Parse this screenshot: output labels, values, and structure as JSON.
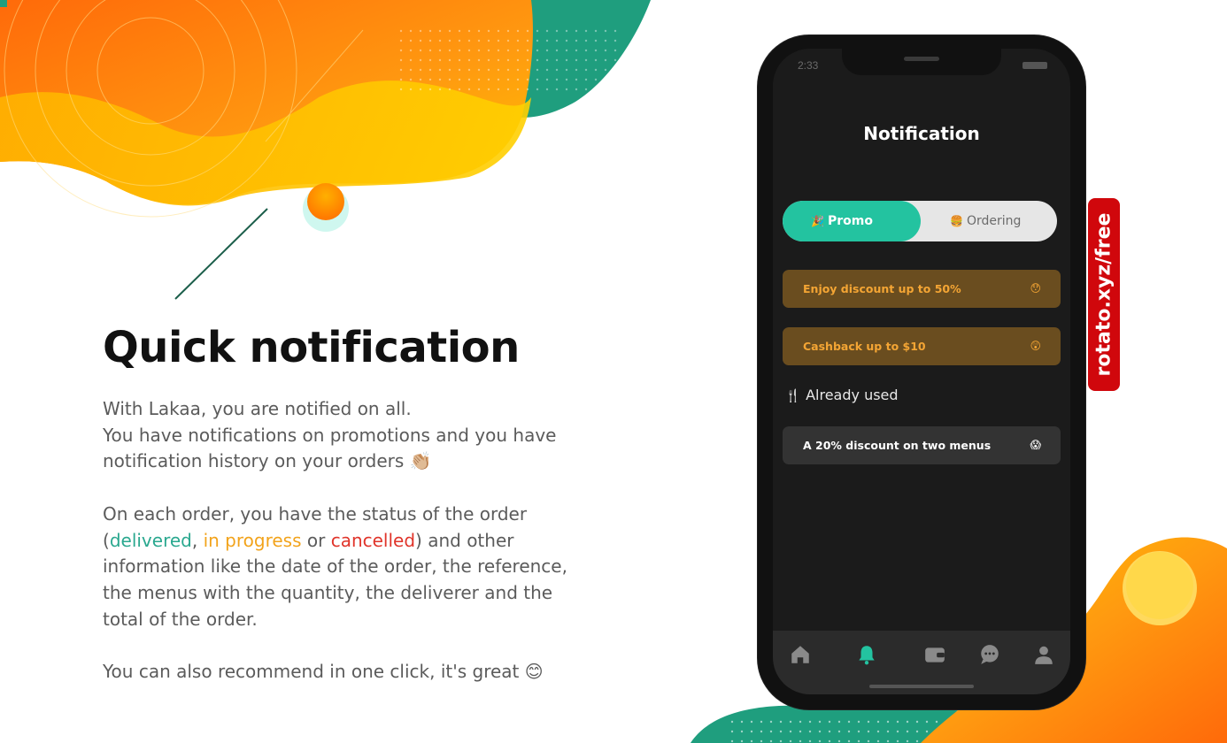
{
  "colors": {
    "accent_teal": "#23c3a0",
    "promo_card_bg": "#6a4d1f",
    "promo_card_text": "#f4a534",
    "delivered": "#2aa88f",
    "in_progress": "#f2a31b",
    "cancelled": "#e0342a",
    "tag_red": "#d0070c"
  },
  "copy": {
    "heading": "Quick notification",
    "p1_line1": "With Lakaa, you are notified on all.",
    "p1_line2": "You have notifications on promotions and you have",
    "p1_line3": "notification history on your orders 👏🏼",
    "p2_line1": "On each order, you have the status of the order",
    "p2_open": "(",
    "p2_delivered": "delivered",
    "p2_comma": ", ",
    "p2_in_progress": "in progress",
    "p2_or": " or ",
    "p2_cancelled": "cancelled",
    "p2_close": ") and other",
    "p2_line3": "information like the date of the order, the reference,",
    "p2_line4": "the menus with the quantity, the deliverer and the",
    "p2_line5": "total of the order.",
    "p3_line1": "You can also recommend in one click, it's great 😊"
  },
  "phone": {
    "status_time": "2:33",
    "screen_title": "Notification",
    "tabs": [
      {
        "emoji": "🎉",
        "label": "Promo",
        "active": true
      },
      {
        "emoji": "🍔",
        "label": "Ordering",
        "active": false
      }
    ],
    "promo_cards": [
      {
        "text": "Enjoy discount up to 50%",
        "emoji": "😯"
      },
      {
        "text": "Cashback up to $10",
        "emoji": "😲"
      }
    ],
    "section_icon": "fork-knife-icon",
    "section_title": "Already used",
    "used_cards": [
      {
        "text": "A 20% discount on two menus",
        "emoji": "😱"
      }
    ],
    "bottom_nav": [
      "home-icon",
      "bell-icon",
      "wallet-icon",
      "chat-icon",
      "profile-icon"
    ],
    "active_nav": "bell-icon"
  },
  "tag": {
    "text": "rotato.xyz/free"
  }
}
